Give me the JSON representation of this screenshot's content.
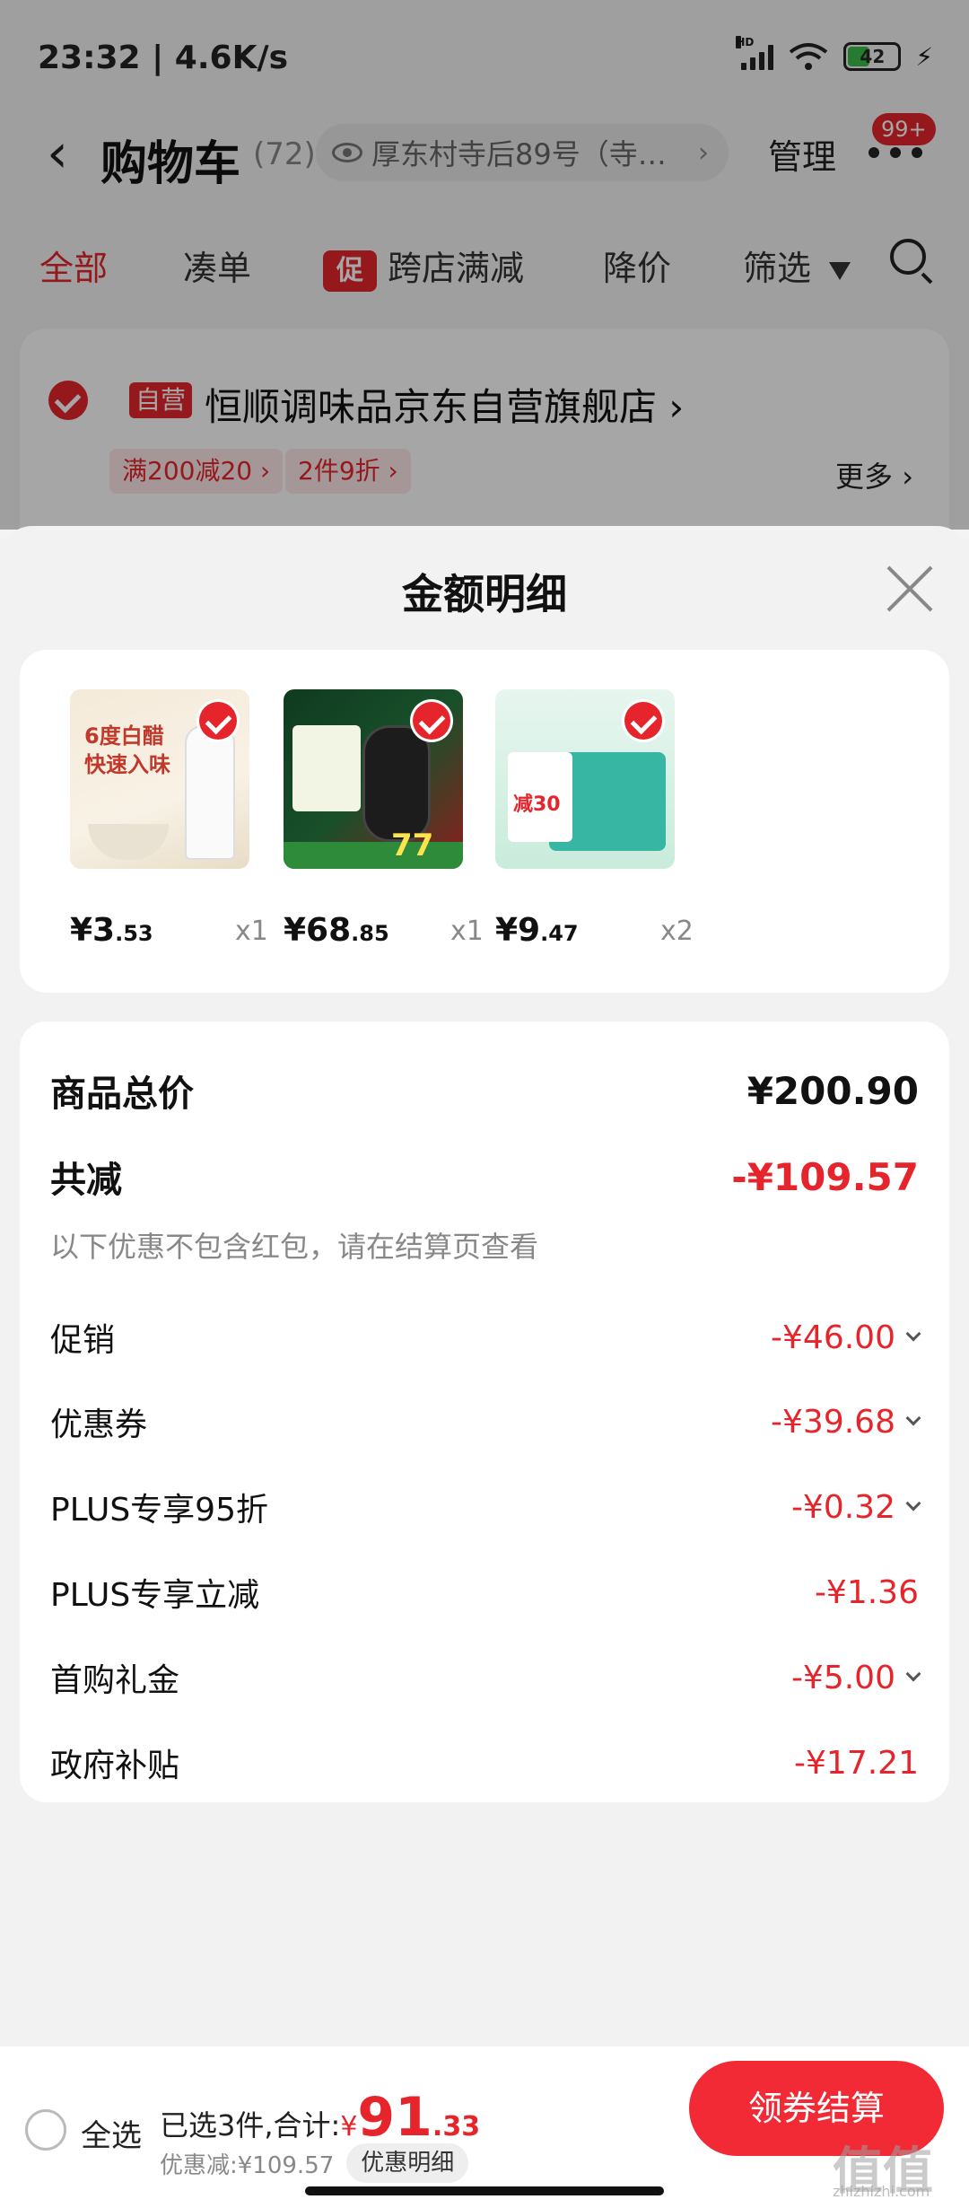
{
  "status": {
    "time": "23:32 | 4.6K/s",
    "battery": "42",
    "network": "HD"
  },
  "header": {
    "title": "购物车",
    "count": "(72)",
    "address": "厚东村寺后89号（寺…",
    "manage": "管理",
    "badge": "99+"
  },
  "tabs": [
    {
      "label": "全部",
      "active": true
    },
    {
      "label": "凑单"
    },
    {
      "label": "跨店满减",
      "tag": "促"
    },
    {
      "label": "降价"
    },
    {
      "label": "筛选"
    }
  ],
  "store": {
    "tag": "自营",
    "name": "恒顺调味品京东自营旗舰店",
    "promos": [
      "满200减20 ›",
      "2件9折 ›"
    ],
    "more": "更多 ›"
  },
  "sheet": {
    "title": "金额明细",
    "products": [
      {
        "price_int": "¥3",
        "price_dec": ".53",
        "qty": "x1",
        "img_text": "6度白醋\n快速入味"
      },
      {
        "price_int": "¥68",
        "price_dec": ".85",
        "qty": "x1",
        "img_text": "77"
      },
      {
        "price_int": "¥9",
        "price_dec": ".47",
        "qty": "x2",
        "img_text": "减30"
      }
    ],
    "details": {
      "total_label": "商品总价",
      "total_value": "¥200.90",
      "reduce_label": "共减",
      "reduce_value": "-¥109.57",
      "note": "以下优惠不包含红包，请在结算页查看",
      "items": [
        {
          "label": "促销",
          "value": "-¥46.00",
          "expandable": true
        },
        {
          "label": "优惠券",
          "value": "-¥39.68",
          "expandable": true
        },
        {
          "label": "PLUS专享95折",
          "value": "-¥0.32",
          "expandable": true
        },
        {
          "label": "PLUS专享立减",
          "value": "-¥1.36",
          "expandable": false
        },
        {
          "label": "首购礼金",
          "value": "-¥5.00",
          "expandable": true
        },
        {
          "label": "政府补贴",
          "value": "-¥17.21",
          "expandable": false
        }
      ]
    }
  },
  "bottom": {
    "select_all": "全选",
    "summary_prefix": "已选3件,合计:",
    "total_currency": "¥",
    "total_int": "91",
    "total_dec": ".33",
    "discount": "优惠减:¥109.57",
    "detail_button": "优惠明细",
    "checkout": "领券结算"
  },
  "watermark": {
    "main": "值值值",
    "sub": "zhizhizhi.com"
  },
  "colors": {
    "accent": "#e5252b",
    "checkout": "#f22a35"
  }
}
